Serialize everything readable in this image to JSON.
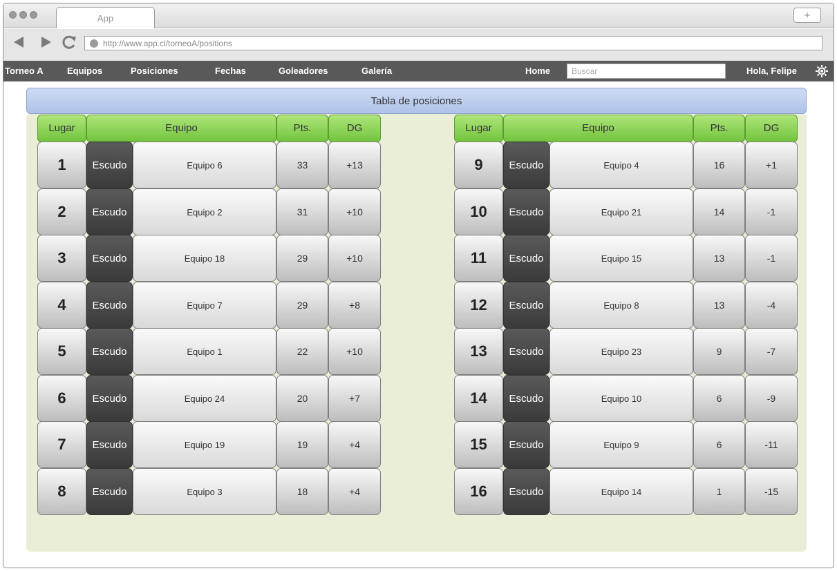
{
  "browser": {
    "tab_title": "App",
    "new_tab": "+",
    "url": "http://www.app.cl/torneoA/positions"
  },
  "menu": {
    "items": [
      "Torneo A",
      "Equipos",
      "Posiciones",
      "Fechas",
      "Goleadores",
      "Galería"
    ],
    "home": "Home",
    "search_placeholder": "Buscar",
    "greeting": "Hola, Felipe"
  },
  "table": {
    "title": "Tabla de posiciones",
    "headers": {
      "lugar": "Lugar",
      "equipo": "Equipo",
      "pts": "Pts.",
      "dg": "DG"
    },
    "shield_label": "Escudo",
    "left": [
      {
        "lugar": "1",
        "equipo": "Equipo 6",
        "pts": "33",
        "dg": "+13"
      },
      {
        "lugar": "2",
        "equipo": "Equipo 2",
        "pts": "31",
        "dg": "+10"
      },
      {
        "lugar": "3",
        "equipo": "Equipo 18",
        "pts": "29",
        "dg": "+10"
      },
      {
        "lugar": "4",
        "equipo": "Equipo 7",
        "pts": "29",
        "dg": "+8"
      },
      {
        "lugar": "5",
        "equipo": "Equipo 1",
        "pts": "22",
        "dg": "+10"
      },
      {
        "lugar": "6",
        "equipo": "Equipo 24",
        "pts": "20",
        "dg": "+7"
      },
      {
        "lugar": "7",
        "equipo": "Equipo 19",
        "pts": "19",
        "dg": "+4"
      },
      {
        "lugar": "8",
        "equipo": "Equipo 3",
        "pts": "18",
        "dg": "+4"
      }
    ],
    "right": [
      {
        "lugar": "9",
        "equipo": "Equipo 4",
        "pts": "16",
        "dg": "+1"
      },
      {
        "lugar": "10",
        "equipo": "Equipo 21",
        "pts": "14",
        "dg": "-1"
      },
      {
        "lugar": "11",
        "equipo": "Equipo 15",
        "pts": "13",
        "dg": "-1"
      },
      {
        "lugar": "12",
        "equipo": "Equipo 8",
        "pts": "13",
        "dg": "-4"
      },
      {
        "lugar": "13",
        "equipo": "Equipo 23",
        "pts": "9",
        "dg": "-7"
      },
      {
        "lugar": "14",
        "equipo": "Equipo 10",
        "pts": "6",
        "dg": "-9"
      },
      {
        "lugar": "15",
        "equipo": "Equipo 9",
        "pts": "6",
        "dg": "-11"
      },
      {
        "lugar": "16",
        "equipo": "Equipo 14",
        "pts": "1",
        "dg": "-15"
      }
    ]
  },
  "colors": {
    "menubar": "#595959",
    "header_green": "#72c43d",
    "title_blue": "#aec3e8",
    "panel_bg": "#ebeed6",
    "shield_dark": "#4a4a4a"
  }
}
